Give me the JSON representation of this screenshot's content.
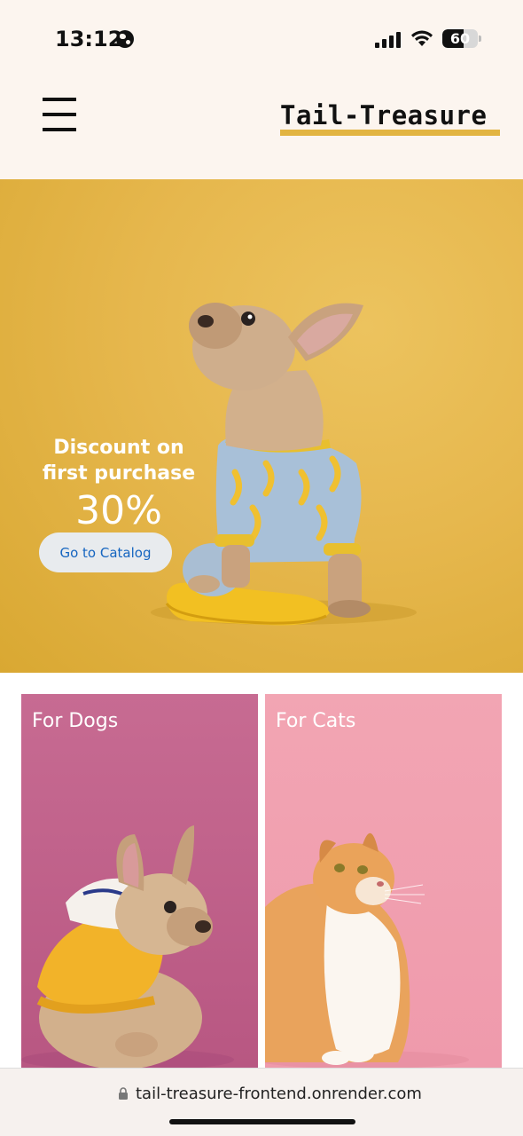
{
  "status_bar": {
    "time": "13:12",
    "battery_percent": "60",
    "battery_level": 0.6
  },
  "header": {
    "logo_text": "Tail-Treasure",
    "menu_icon": "hamburger-menu-icon",
    "accent_color": "#e2b441"
  },
  "hero": {
    "title": "Discount on first purchase",
    "discount": "30%",
    "cta_label": "Go to Catalog",
    "background_color": "#e6b74d"
  },
  "categories": [
    {
      "label": "For Dogs",
      "color": "#c76b92"
    },
    {
      "label": "For Cats",
      "color": "#f2a5b3"
    }
  ],
  "browser": {
    "url": "tail-treasure-frontend.onrender.com"
  }
}
